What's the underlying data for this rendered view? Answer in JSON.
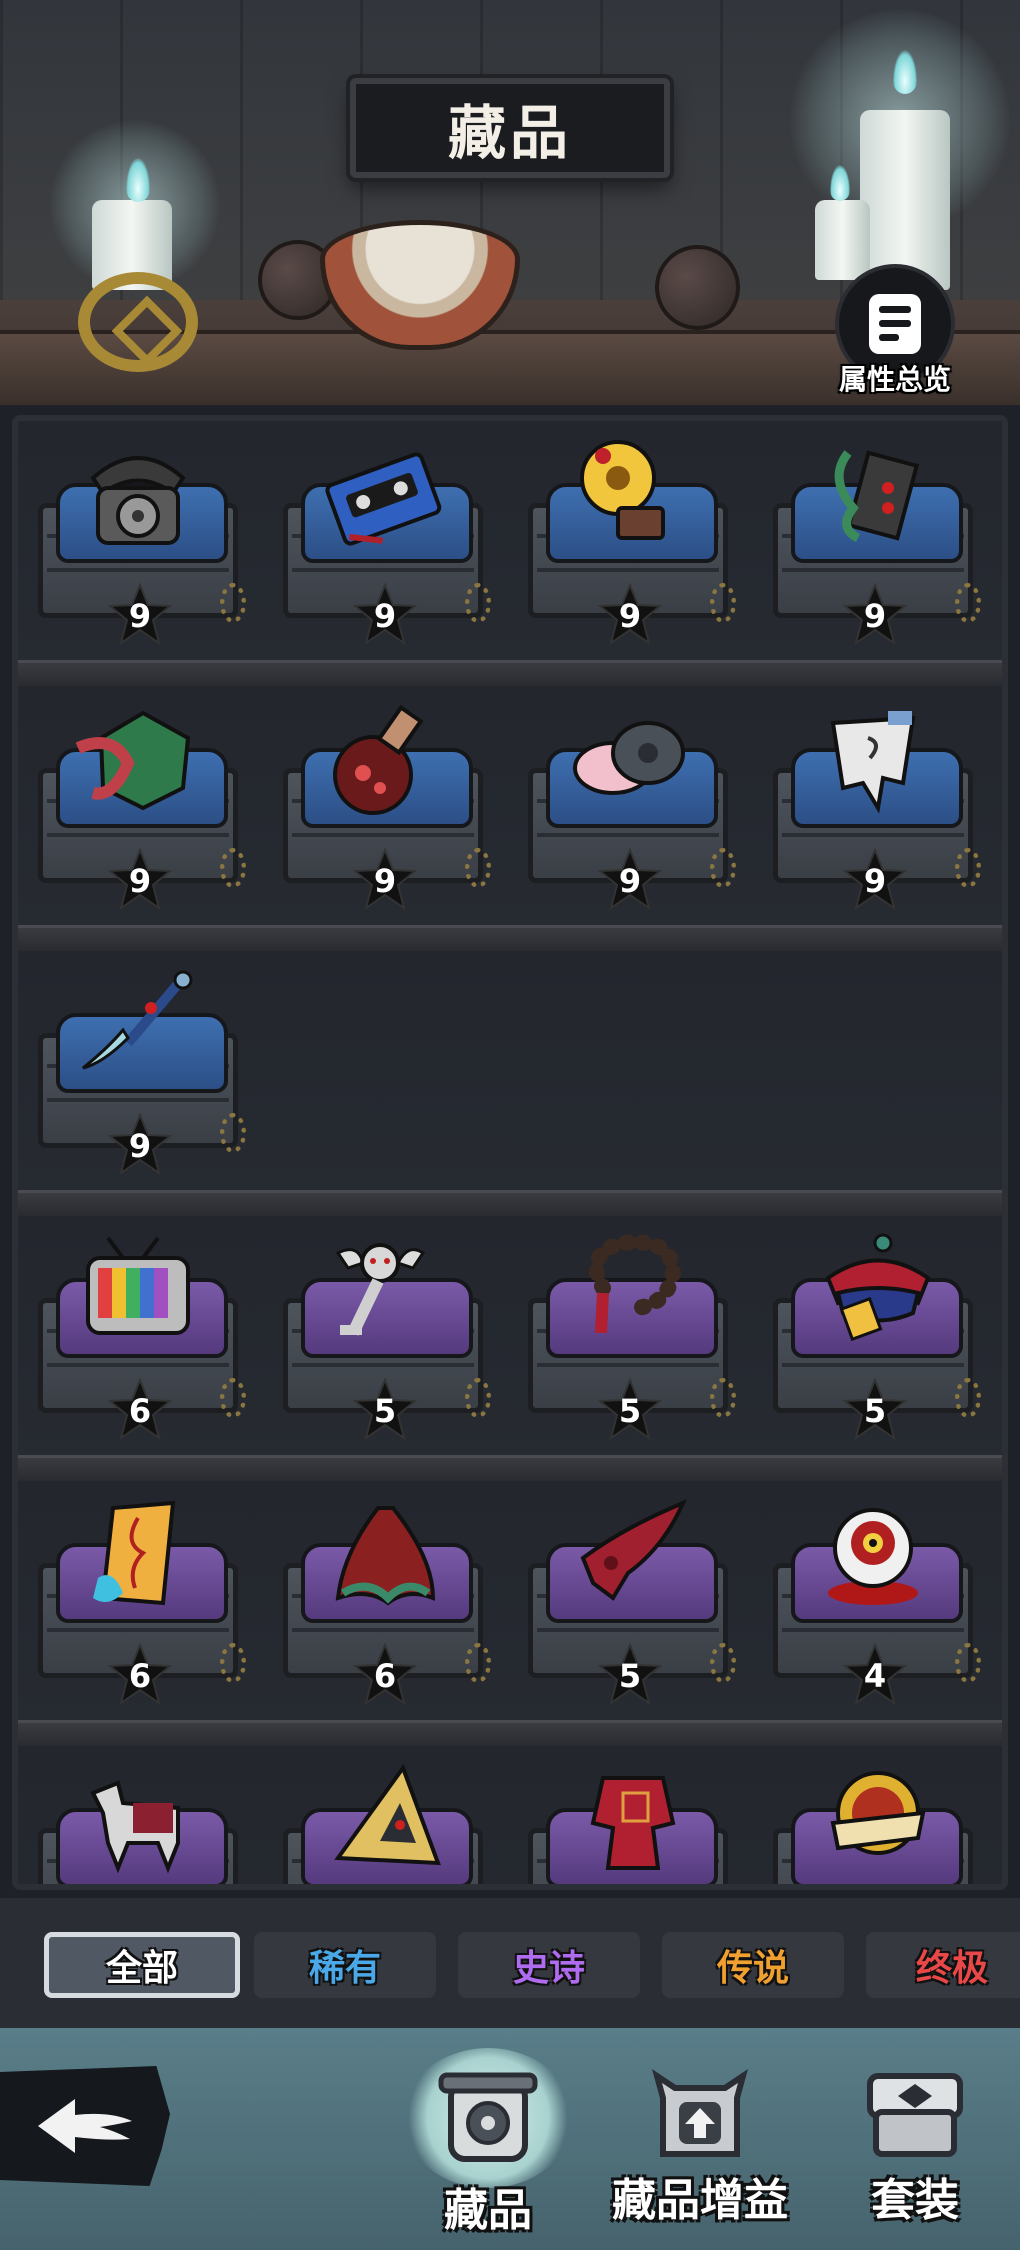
{
  "header": {
    "title": "藏品",
    "overview_label": "属性总览"
  },
  "colors": {
    "blue_cushion": "#3e6fb0",
    "purple_cushion": "#7a5aa8",
    "tab_rare": "#4aa8e8",
    "tab_epic": "#b06cf0",
    "tab_legend": "#f0a030",
    "tab_ultimate": "#e84848"
  },
  "collection": {
    "rows": [
      {
        "rarity": "blue",
        "items": [
          {
            "icon": "rotary-phone-icon",
            "level": "9"
          },
          {
            "icon": "cassette-tape-icon",
            "level": "9"
          },
          {
            "icon": "gramophone-icon",
            "level": "9"
          },
          {
            "icon": "tentacle-book-icon",
            "level": "9"
          }
        ]
      },
      {
        "rarity": "blue",
        "items": [
          {
            "icon": "dice-tentacle-icon",
            "level": "9"
          },
          {
            "icon": "potion-flask-icon",
            "level": "9"
          },
          {
            "icon": "powder-compact-icon",
            "level": "9"
          },
          {
            "icon": "ghost-cloth-icon",
            "level": "9"
          }
        ]
      },
      {
        "rarity": "blue",
        "items": [
          {
            "icon": "calligraphy-brush-icon",
            "level": "9"
          }
        ]
      },
      {
        "rarity": "purple",
        "items": [
          {
            "icon": "retro-tv-icon",
            "level": "6"
          },
          {
            "icon": "angel-key-icon",
            "level": "5"
          },
          {
            "icon": "prayer-beads-icon",
            "level": "5"
          },
          {
            "icon": "official-hat-icon",
            "level": "5"
          }
        ]
      },
      {
        "rarity": "purple",
        "items": [
          {
            "icon": "talisman-paper-icon",
            "level": "6"
          },
          {
            "icon": "red-cape-icon",
            "level": "6"
          },
          {
            "icon": "red-horn-icon",
            "level": "5"
          },
          {
            "icon": "bloody-eyeball-icon",
            "level": "4"
          }
        ]
      },
      {
        "rarity": "purple",
        "items": [
          {
            "icon": "paper-horse-icon"
          },
          {
            "icon": "triangle-ruler-icon"
          },
          {
            "icon": "red-robe-icon"
          },
          {
            "icon": "gold-medal-icon"
          }
        ]
      }
    ]
  },
  "tabs": [
    {
      "label": "全部",
      "active": true
    },
    {
      "label": "稀有"
    },
    {
      "label": "史诗"
    },
    {
      "label": "传说"
    },
    {
      "label": "终极"
    }
  ],
  "nav": {
    "items": [
      {
        "label": "藏品",
        "icon": "collection-box-icon",
        "active": true
      },
      {
        "label": "藏品增益",
        "icon": "upgrade-box-icon"
      },
      {
        "label": "套装",
        "icon": "set-box-icon"
      }
    ]
  }
}
